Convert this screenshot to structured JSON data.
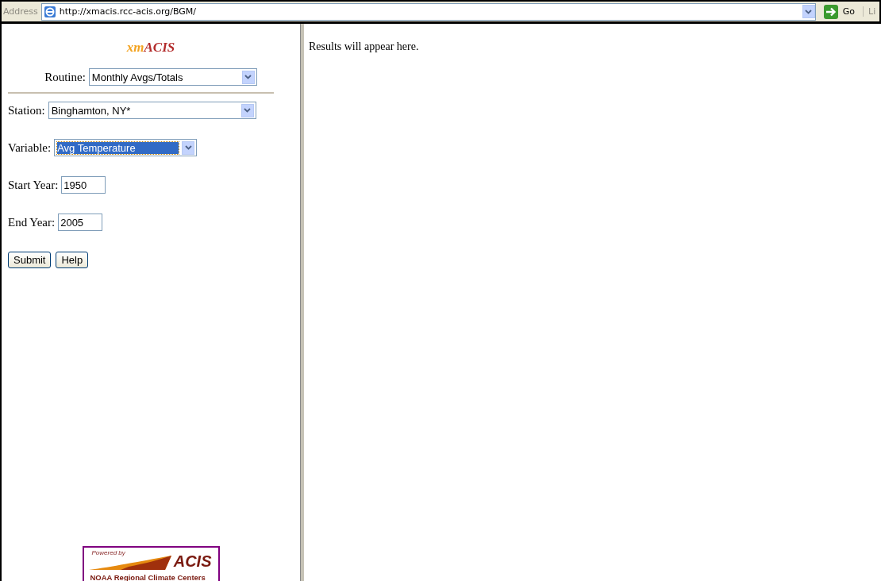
{
  "address_bar": {
    "label": "Address",
    "url": "http://xmacis.rcc-acis.org/BGM/",
    "go_label": "Go",
    "links_label": "Li"
  },
  "sidebar": {
    "title_parts": [
      "xm",
      "ACIS"
    ],
    "routine": {
      "label": "Routine:",
      "value": "Monthly Avgs/Totals"
    },
    "station": {
      "label": "Station:",
      "value": "Binghamton, NY*"
    },
    "variable": {
      "label": "Variable:",
      "value": "Avg Temperature",
      "focused": true
    },
    "start_year": {
      "label": "Start Year:",
      "value": "1950"
    },
    "end_year": {
      "label": "End Year:",
      "value": "2005"
    },
    "buttons": [
      "Submit",
      "Help"
    ],
    "badge": {
      "powered": "Powered by",
      "name": "ACIS",
      "org": "NOAA Regional Climate Centers"
    }
  },
  "main": {
    "message": "Results will appear here."
  }
}
